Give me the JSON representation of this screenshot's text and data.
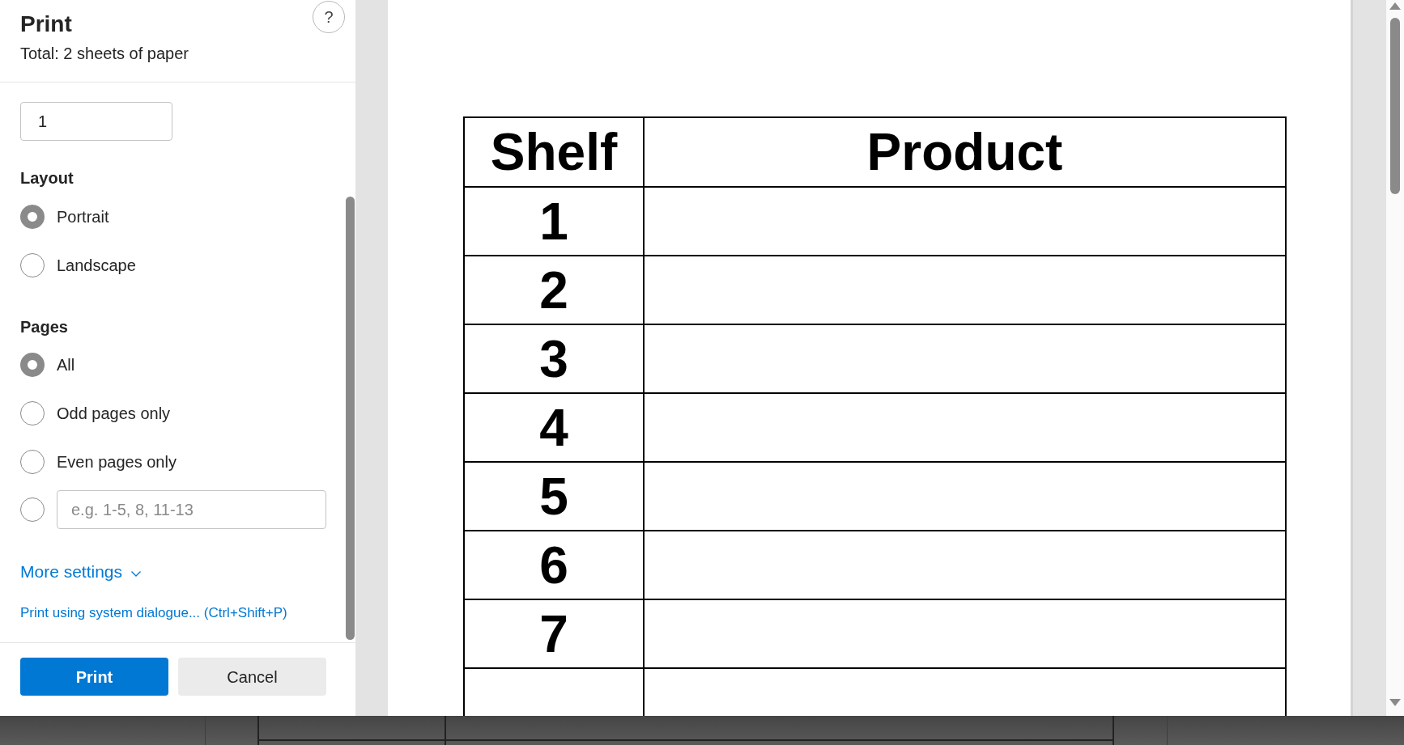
{
  "dialog": {
    "title": "Print",
    "summary": "Total: 2 sheets of paper",
    "help": "?"
  },
  "copies": {
    "value": "1"
  },
  "layout": {
    "heading": "Layout",
    "options": [
      {
        "label": "Portrait",
        "selected": true
      },
      {
        "label": "Landscape",
        "selected": false
      }
    ]
  },
  "pages": {
    "heading": "Pages",
    "options": [
      {
        "kind": "label",
        "label": "All",
        "selected": true
      },
      {
        "kind": "label",
        "label": "Odd pages only",
        "selected": false
      },
      {
        "kind": "label",
        "label": "Even pages only",
        "selected": false
      },
      {
        "kind": "input",
        "placeholder": "e.g. 1-5, 8, 11-13",
        "selected": false
      }
    ]
  },
  "more_settings": {
    "label": "More settings",
    "expanded": false
  },
  "system_dialog_link": "Print using system dialogue... (Ctrl+Shift+P)",
  "buttons": [
    {
      "kind": "primary",
      "label": "Print"
    },
    {
      "kind": "secondary",
      "label": "Cancel"
    }
  ],
  "preview": {
    "columns": [
      "Shelf",
      "Product"
    ],
    "rows": [
      {
        "shelf": "1"
      },
      {
        "shelf": "2"
      },
      {
        "shelf": "3"
      },
      {
        "shelf": "4"
      },
      {
        "shelf": "5"
      },
      {
        "shelf": "6"
      },
      {
        "shelf": "7"
      }
    ],
    "continues_below": true
  }
}
